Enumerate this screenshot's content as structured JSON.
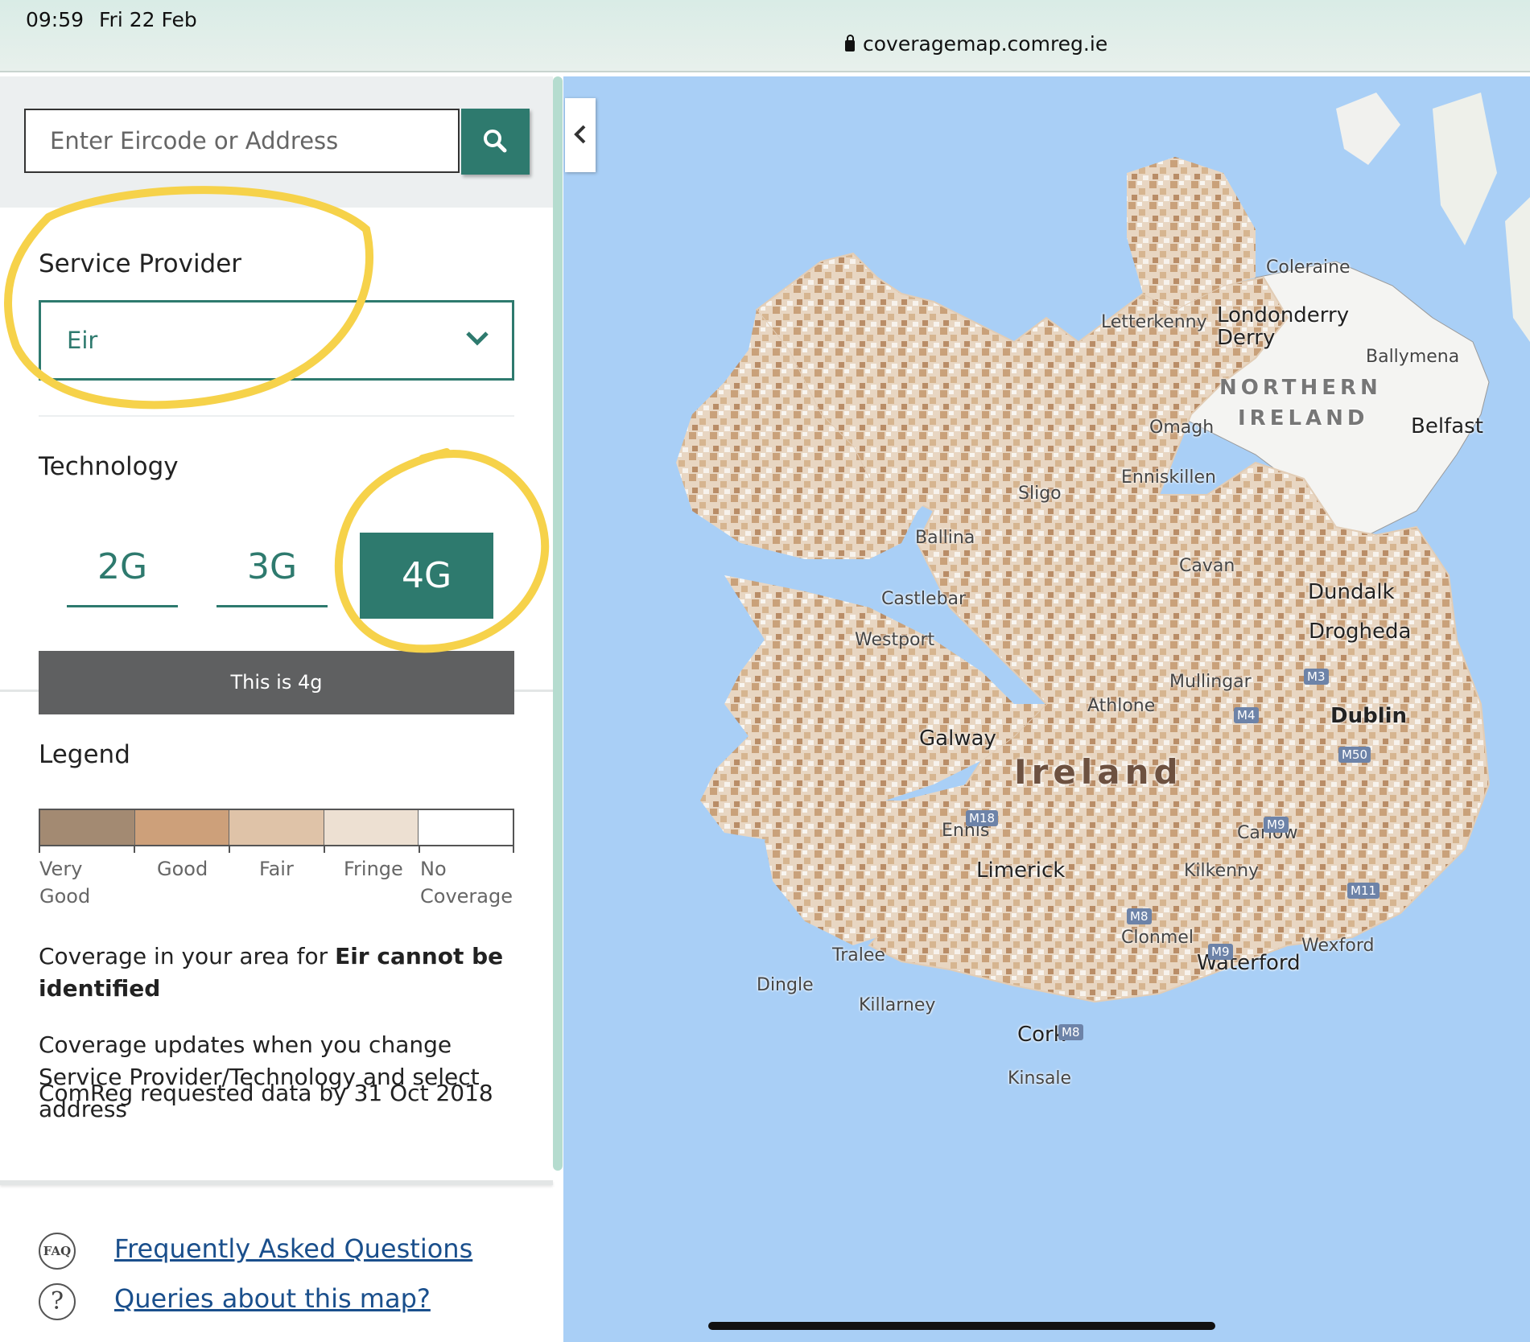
{
  "status": {
    "time": "09:59",
    "date": "Fri 22 Feb",
    "url": "coveragemap.comreg.ie"
  },
  "search": {
    "placeholder": "Enter Eircode or Address"
  },
  "provider": {
    "title": "Service Provider",
    "selected": "Eir"
  },
  "technology": {
    "title": "Technology",
    "options": [
      "2G",
      "3G",
      "4G"
    ],
    "selected": "4G",
    "info": "This is 4g"
  },
  "legend": {
    "title": "Legend",
    "items": [
      {
        "label_1": "Very",
        "label_2": "Good",
        "color": "#a38a72"
      },
      {
        "label_1": "Good",
        "label_2": "",
        "color": "#cda07a"
      },
      {
        "label_1": "Fair",
        "label_2": "",
        "color": "#dfc3a8"
      },
      {
        "label_1": "Fringe",
        "label_2": "",
        "color": "#ede0d2"
      },
      {
        "label_1": "No",
        "label_2": "Coverage",
        "color": "#ffffff"
      }
    ]
  },
  "coverage": {
    "status_prefix": "Coverage in your area for ",
    "status_bold": "Eir cannot be identified",
    "note": "Coverage updates when you change Service Provider/Technology and select address",
    "data_date": "ComReg requested data by 31 Oct 2018"
  },
  "links": {
    "faq_icon": "FAQ",
    "faq": "Frequently Asked Questions",
    "queries_icon": "?",
    "queries": "Queries about this map?"
  },
  "map": {
    "labels": {
      "coleraine": "Coleraine",
      "letterkenny": "Letterkenny",
      "londonderry": "Londonderry",
      "derry": "Derry",
      "ballymena": "Ballymena",
      "northern": "NORTHERN",
      "ireland_ni": "IRELAND",
      "omagh": "Omagh",
      "belfast": "Belfast",
      "enniskillen": "Enniskillen",
      "sligo": "Sligo",
      "ballina": "Ballina",
      "cavan": "Cavan",
      "dundalk": "Dundalk",
      "castlebar": "Castlebar",
      "westport": "Westport",
      "drogheda": "Drogheda",
      "mullingar": "Mullingar",
      "athlone": "Athlone",
      "dublin": "Dublin",
      "galway": "Galway",
      "ireland": "Ireland",
      "ennis": "Ennis",
      "carlow": "Carlow",
      "limerick": "Limerick",
      "kilkenny": "Kilkenny",
      "clonmel": "Clonmel",
      "wexford": "Wexford",
      "tralee": "Tralee",
      "waterford": "Waterford",
      "dingle": "Dingle",
      "killarney": "Killarney",
      "cork": "Cork",
      "kinsale": "Kinsale"
    },
    "roads": {
      "m3": "M3",
      "m4": "M4",
      "m50": "M50",
      "m18": "M18",
      "m9": "M9",
      "m11": "M11",
      "m8": "M8",
      "m9b": "M9",
      "m8b": "M8"
    },
    "colors": {
      "sea": "#a9cff6",
      "land": "#eee3d6",
      "ni_land": "#f4f4f2",
      "coverage_dark": "#c49a72"
    }
  },
  "annotation_color": "#f6d24a"
}
